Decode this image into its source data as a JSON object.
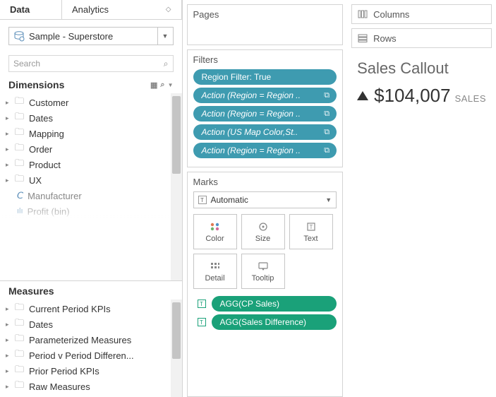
{
  "tabs": {
    "data": "Data",
    "analytics": "Analytics"
  },
  "datasource": {
    "label": "Sample - Superstore"
  },
  "search": {
    "placeholder": "Search"
  },
  "dimensions": {
    "title": "Dimensions",
    "items": [
      "Customer",
      "Dates",
      "Mapping",
      "Order",
      "Product",
      "UX"
    ],
    "attrs": {
      "manufacturer": "Manufacturer",
      "profit_bin": "Profit (bin)"
    }
  },
  "measures": {
    "title": "Measures",
    "items": [
      "Current Period KPIs",
      "Dates",
      "Parameterized Measures",
      "Period v Period Differen...",
      "Prior Period KPIs",
      "Raw Measures"
    ]
  },
  "pages": {
    "title": "Pages"
  },
  "filters": {
    "title": "Filters",
    "pills": [
      {
        "label": "Region Filter: True",
        "italic": false,
        "icon": ""
      },
      {
        "label": "Action (Region = Region ..",
        "italic": true,
        "icon": "link"
      },
      {
        "label": "Action (Region = Region ..",
        "italic": true,
        "icon": "link"
      },
      {
        "label": "Action (US Map Color,St..",
        "italic": true,
        "icon": "link"
      },
      {
        "label": "Action (Region = Region ..",
        "italic": true,
        "icon": "link"
      }
    ]
  },
  "marks": {
    "title": "Marks",
    "type": "Automatic",
    "buttons": {
      "color": "Color",
      "size": "Size",
      "text": "Text",
      "detail": "Detail",
      "tooltip": "Tooltip"
    },
    "pills": [
      "AGG(CP Sales)",
      "AGG(Sales Difference)"
    ]
  },
  "shelves": {
    "columns": "Columns",
    "rows": "Rows"
  },
  "viz": {
    "title": "Sales Callout",
    "value": "$104,007",
    "label": "SALES"
  }
}
